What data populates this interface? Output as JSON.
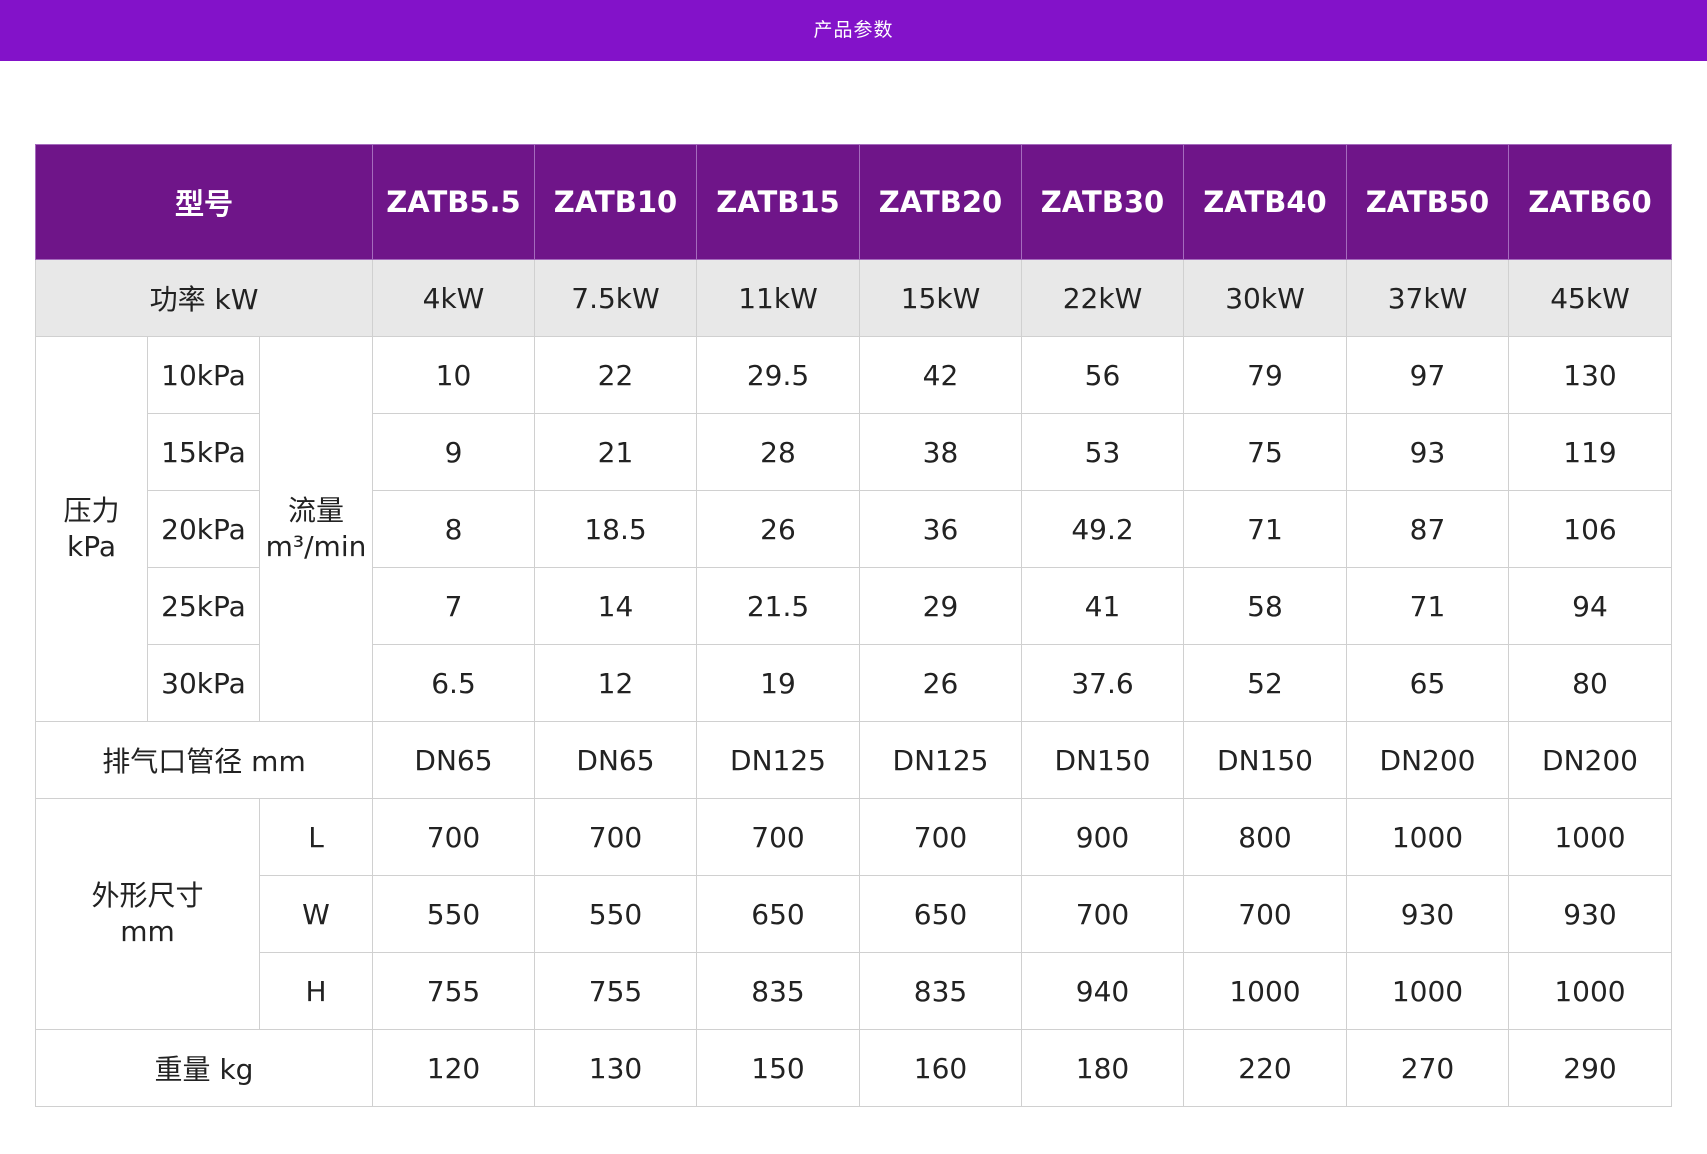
{
  "header": {
    "title": "产品参数"
  },
  "table": {
    "model_label": "型号",
    "models": [
      "ZATB5.5",
      "ZATB10",
      "ZATB15",
      "ZATB20",
      "ZATB30",
      "ZATB40",
      "ZATB50",
      "ZATB60"
    ],
    "power": {
      "label": "功率 kW",
      "values": [
        "4kW",
        "7.5kW",
        "11kW",
        "15kW",
        "22kW",
        "30kW",
        "37kW",
        "45kW"
      ]
    },
    "pressure": {
      "label_line1": "压力",
      "label_line2": "kPa",
      "flow_label_line1": "流量",
      "flow_label_line2": "m³/min",
      "rows": [
        {
          "level": "10kPa",
          "values": [
            "10",
            "22",
            "29.5",
            "42",
            "56",
            "79",
            "97",
            "130"
          ]
        },
        {
          "level": "15kPa",
          "values": [
            "9",
            "21",
            "28",
            "38",
            "53",
            "75",
            "93",
            "119"
          ]
        },
        {
          "level": "20kPa",
          "values": [
            "8",
            "18.5",
            "26",
            "36",
            "49.2",
            "71",
            "87",
            "106"
          ]
        },
        {
          "level": "25kPa",
          "values": [
            "7",
            "14",
            "21.5",
            "29",
            "41",
            "58",
            "71",
            "94"
          ]
        },
        {
          "level": "30kPa",
          "values": [
            "6.5",
            "12",
            "19",
            "26",
            "37.6",
            "52",
            "65",
            "80"
          ]
        }
      ]
    },
    "exhaust": {
      "label": "排气口管径 mm",
      "values": [
        "DN65",
        "DN65",
        "DN125",
        "DN125",
        "DN150",
        "DN150",
        "DN200",
        "DN200"
      ]
    },
    "dimensions": {
      "label_line1": "外形尺寸",
      "label_line2": "mm",
      "rows": [
        {
          "axis": "L",
          "values": [
            "700",
            "700",
            "700",
            "700",
            "900",
            "800",
            "1000",
            "1000"
          ]
        },
        {
          "axis": "W",
          "values": [
            "550",
            "550",
            "650",
            "650",
            "700",
            "700",
            "930",
            "930"
          ]
        },
        {
          "axis": "H",
          "values": [
            "755",
            "755",
            "835",
            "835",
            "940",
            "1000",
            "1000",
            "1000"
          ]
        }
      ]
    },
    "weight": {
      "label": "重量 kg",
      "values": [
        "120",
        "130",
        "150",
        "160",
        "180",
        "220",
        "270",
        "290"
      ]
    }
  },
  "colors": {
    "topbar": "#8312c9",
    "header_row": "#6f1589",
    "power_row": "#e8e8e8",
    "border": "#d0d0d0"
  }
}
